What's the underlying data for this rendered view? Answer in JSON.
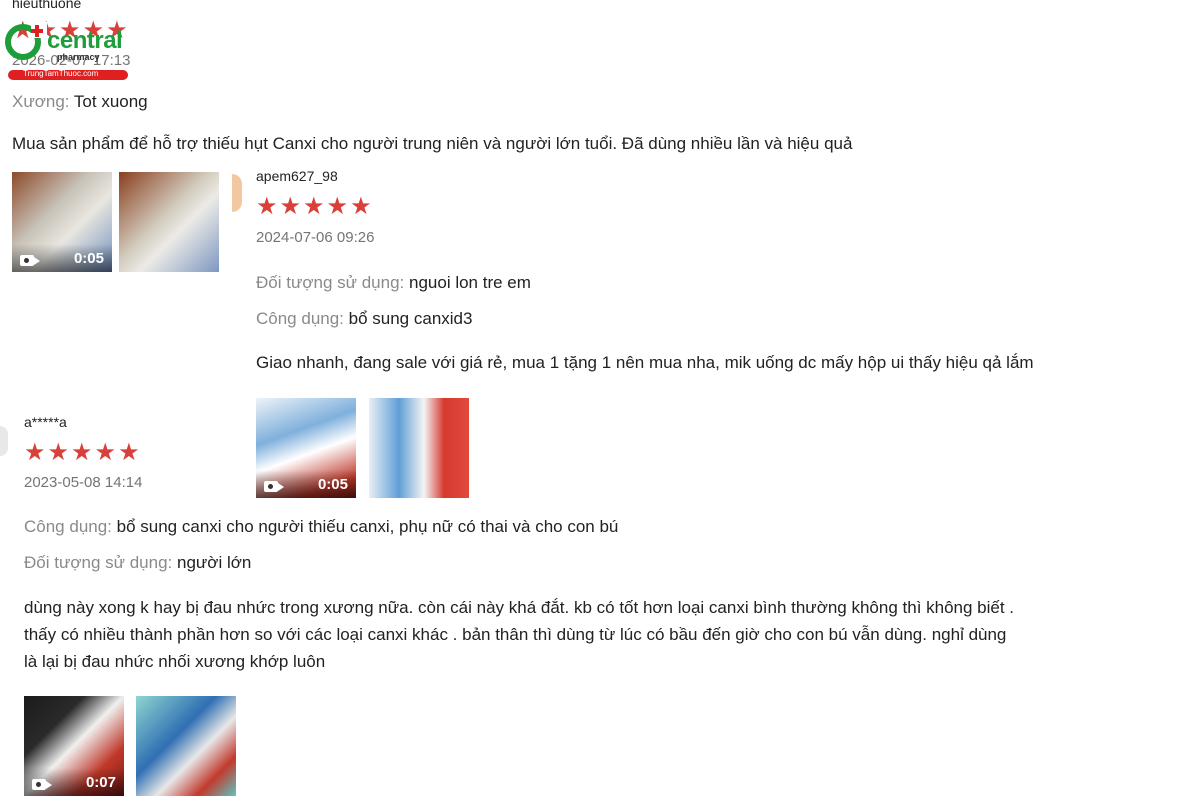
{
  "brand": {
    "name": "central",
    "sub": "pharmacy",
    "url": "TrungTamThuoc.com",
    "color_primary": "#1e9e3a",
    "color_accent": "#e02020"
  },
  "star_color": "#d9403a",
  "reviews": [
    {
      "username": "hieuthuone",
      "stars": 5,
      "date": "2026-02-07 17:13",
      "attributes": [
        {
          "key": "Xương:",
          "value": "Tot xuong"
        }
      ],
      "comment": "Mua sản phẩm để hỗ trợ thiếu hụt Canxi cho người trung niên và người lớn tuổi. Đã dùng nhiều lần và hiệu quả",
      "media": [
        {
          "type": "video",
          "duration": "0:05"
        },
        {
          "type": "image"
        }
      ]
    },
    {
      "username": "apem627_98",
      "stars": 5,
      "date": "2024-07-06 09:26",
      "attributes": [
        {
          "key": "Đối tượng sử dụng:",
          "value": "nguoi lon tre em"
        },
        {
          "key": "Công dụng:",
          "value": "bổ sung canxid3"
        }
      ],
      "comment": "Giao nhanh, đang sale với giá rẻ, mua 1 tặng 1 nên mua nha, mik uống dc mấy hộp ui thấy hiệu qả lắm",
      "media": [
        {
          "type": "video",
          "duration": "0:05"
        },
        {
          "type": "image"
        }
      ]
    },
    {
      "username": "a*****a",
      "stars": 5,
      "date": "2023-05-08 14:14",
      "attributes": [
        {
          "key": "Công dụng:",
          "value": "bổ sung canxi cho người thiếu canxi, phụ nữ có thai và cho con bú"
        },
        {
          "key": "Đối tượng sử dụng:",
          "value": "người lớn"
        }
      ],
      "comment_lines": [
        "dùng này xong k hay bị đau nhức trong xương nữa. còn cái này khá đắt. kb có tốt hơn loại canxi bình thường không thì không biết .",
        "thấy có nhiều thành phần hơn so với các loại canxi khác . bản thân thì dùng từ lúc có bầu đến giờ cho con bú vẫn dùng. nghỉ dùng",
        "là lại bị đau nhức nhối xương khớp luôn"
      ],
      "media": [
        {
          "type": "video",
          "duration": "0:07"
        },
        {
          "type": "image"
        }
      ]
    }
  ]
}
